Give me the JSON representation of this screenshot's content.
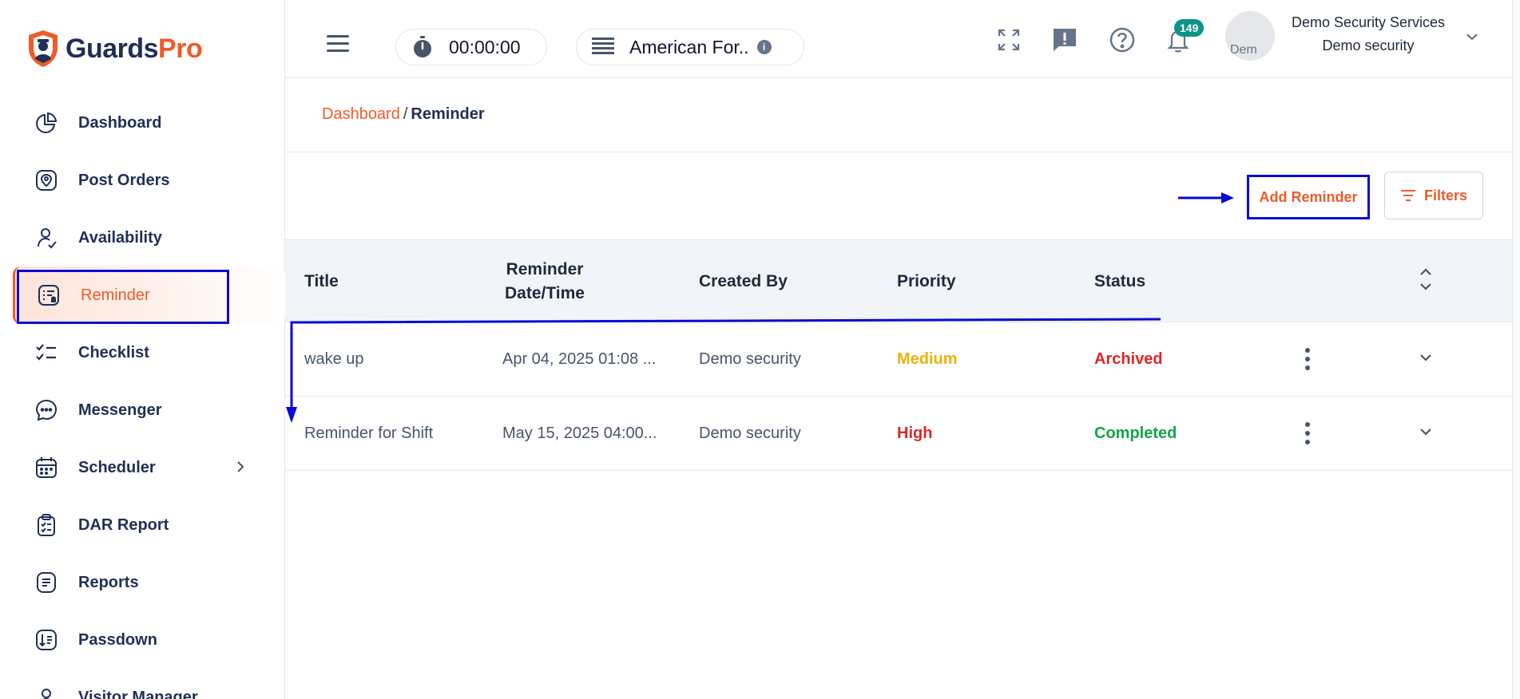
{
  "brand": {
    "part1": "Guards",
    "part2": "Pro",
    "color_primary": "#1f2f56",
    "color_accent": "#f05a28"
  },
  "sidebar": {
    "items": [
      {
        "label": "Dashboard",
        "icon": "pie-chart-icon"
      },
      {
        "label": "Post Orders",
        "icon": "location-badge-icon"
      },
      {
        "label": "Availability",
        "icon": "user-check-icon"
      },
      {
        "label": "Reminder",
        "icon": "reminder-list-icon",
        "active": true
      },
      {
        "label": "Checklist",
        "icon": "checklist-icon"
      },
      {
        "label": "Messenger",
        "icon": "chat-bubble-icon"
      },
      {
        "label": "Scheduler",
        "icon": "calendar-icon",
        "has_submenu": true
      },
      {
        "label": "DAR Report",
        "icon": "clipboard-check-icon"
      },
      {
        "label": "Reports",
        "icon": "document-lines-icon"
      },
      {
        "label": "Passdown",
        "icon": "passdown-icon"
      },
      {
        "label": "Visitor Manager",
        "icon": "visitor-icon"
      }
    ]
  },
  "header": {
    "timer": "00:00:00",
    "company": "American For..",
    "notification_count": "149",
    "avatar_alt": "Dem",
    "user_company": "Demo Security Services",
    "user_name": "Demo security"
  },
  "breadcrumb": {
    "home": "Dashboard",
    "separator": "/",
    "current": "Reminder"
  },
  "toolbar": {
    "add_label": "Add Reminder",
    "filter_label": "Filters"
  },
  "table": {
    "headers": [
      "Title",
      "Reminder Date/Time",
      "Created By",
      "Priority",
      "Status"
    ],
    "rows": [
      {
        "title": "wake up",
        "datetime": "Apr 04, 2025 01:08 ...",
        "created_by": "Demo security",
        "priority": "Medium",
        "status": "Archived"
      },
      {
        "title": "Reminder for Shift",
        "datetime": "May 15, 2025 04:00...",
        "created_by": "Demo security",
        "priority": "High",
        "status": "Completed"
      }
    ]
  },
  "colors": {
    "annotation": "#0a0ad6",
    "priority_medium": "#eab308",
    "priority_high": "#dc2626",
    "status_archived": "#dc2626",
    "status_completed": "#16a34a",
    "badge": "#0d9488"
  }
}
